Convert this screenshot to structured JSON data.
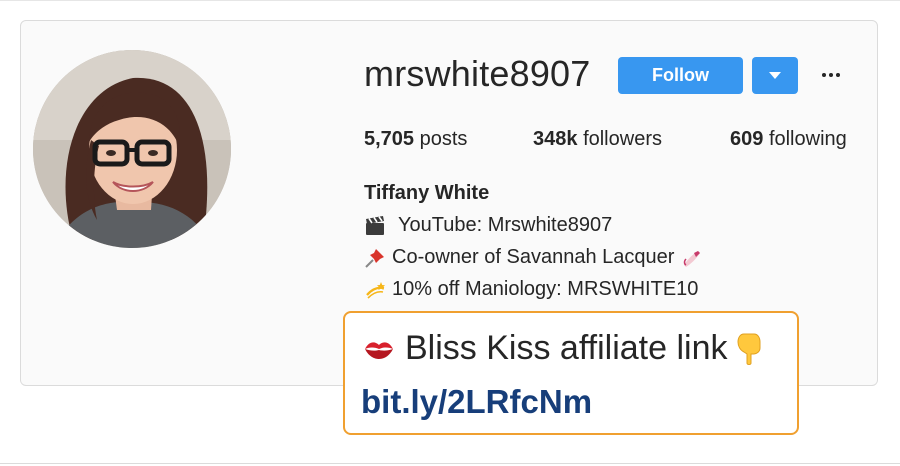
{
  "profile": {
    "username": "mrswhite8907",
    "follow_label": "Follow",
    "stats": {
      "posts_count": "5,705",
      "posts_label": "posts",
      "followers_count": "348k",
      "followers_label": "followers",
      "following_count": "609",
      "following_label": "following"
    },
    "full_name": "Tiffany White",
    "bio": [
      {
        "icon": "clapper-board-icon",
        "text": "YouTube: Mrswhite8907"
      },
      {
        "icon": "pushpin-icon",
        "text": "Co-owner of Savannah Lacquer",
        "trailing_icon": "nail-polish-icon"
      },
      {
        "icon": "dizzy-icon",
        "text": "10% off Maniology: MRSWHITE10"
      }
    ]
  },
  "callout": {
    "icon": "kiss-mark-icon",
    "title": "Bliss Kiss affiliate link",
    "trailing_icon": "pointing-down-icon",
    "link": "bit.ly/2LRfcNm"
  },
  "colors": {
    "accent": "#3897f0",
    "callout_border": "#f0a030",
    "link": "#173e7a",
    "text": "#262626"
  }
}
